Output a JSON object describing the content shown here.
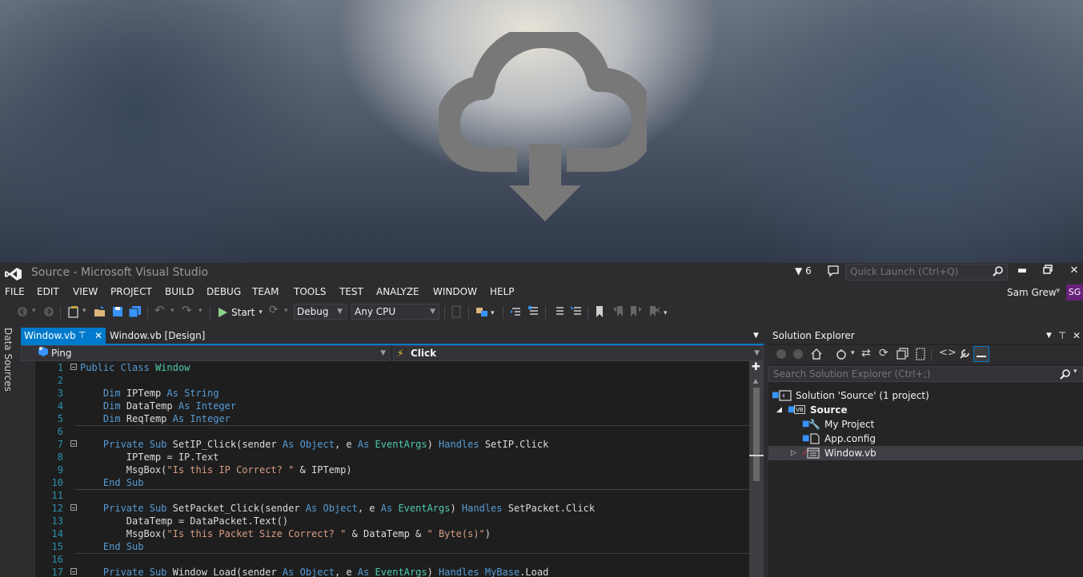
{
  "wallpaper": {
    "icon": "cloud-download-icon"
  },
  "titlebar": {
    "title": "Source - Microsoft Visual Studio",
    "notification_count": "6",
    "quick_launch_placeholder": "Quick Launch (Ctrl+Q)"
  },
  "menu": [
    "FILE",
    "EDIT",
    "VIEW",
    "PROJECT",
    "BUILD",
    "DEBUG",
    "TEAM",
    "TOOLS",
    "TEST",
    "ANALYZE",
    "WINDOW",
    "HELP"
  ],
  "user": {
    "name": "Sam Grew",
    "initials": "SG"
  },
  "toolbar": {
    "start_label": "Start",
    "config": "Debug",
    "platform": "Any CPU"
  },
  "side_panel": {
    "label": "Data Sources"
  },
  "tabs": {
    "active": "Window.vb",
    "inactive": "Window.vb [Design]"
  },
  "navbar": {
    "left": "Ping",
    "right": "Click"
  },
  "code_lines": [
    {
      "n": "1",
      "html": "<span class=\"kw\">Public</span> <span class=\"kw\">Class</span> <span class=\"ty\">Window</span>"
    },
    {
      "n": "2",
      "html": ""
    },
    {
      "n": "3",
      "html": "    <span class=\"kw\">Dim</span> IPTemp <span class=\"kw\">As</span> <span class=\"kw\">String</span>"
    },
    {
      "n": "4",
      "html": "    <span class=\"kw\">Dim</span> DataTemp <span class=\"kw\">As</span> <span class=\"kw\">Integer</span>"
    },
    {
      "n": "5",
      "html": "    <span class=\"kw\">Dim</span> ReqTemp <span class=\"kw\">As</span> <span class=\"kw\">Integer</span>"
    },
    {
      "n": "6",
      "html": ""
    },
    {
      "n": "7",
      "html": "    <span class=\"kw\">Private</span> <span class=\"kw\">Sub</span> SetIP_Click(sender <span class=\"kw\">As</span> <span class=\"kw\">Object</span>, e <span class=\"kw\">As</span> <span class=\"ty\">EventArgs</span>) <span class=\"kw\">Handles</span> SetIP.Click"
    },
    {
      "n": "8",
      "html": "        IPTemp = IP.Text"
    },
    {
      "n": "9",
      "html": "        MsgBox(<span class=\"st\">\"Is this IP Correct? \"</span> &amp; IPTemp)"
    },
    {
      "n": "10",
      "html": "    <span class=\"kw\">End</span> <span class=\"kw\">Sub</span>"
    },
    {
      "n": "11",
      "html": ""
    },
    {
      "n": "12",
      "html": "    <span class=\"kw\">Private</span> <span class=\"kw\">Sub</span> SetPacket_Click(sender <span class=\"kw\">As</span> <span class=\"kw\">Object</span>, e <span class=\"kw\">As</span> <span class=\"ty\">EventArgs</span>) <span class=\"kw\">Handles</span> SetPacket.Click"
    },
    {
      "n": "13",
      "html": "        DataTemp = DataPacket.Text()"
    },
    {
      "n": "14",
      "html": "        MsgBox(<span class=\"st\">\"Is this Packet Size Correct? \"</span> &amp; DataTemp &amp; <span class=\"st\">\" Byte(s)\"</span>)"
    },
    {
      "n": "15",
      "html": "    <span class=\"kw\">End</span> <span class=\"kw\">Sub</span>"
    },
    {
      "n": "16",
      "html": ""
    },
    {
      "n": "17",
      "html": "    <span class=\"kw\">Private</span> <span class=\"kw\">Sub</span> Window_Load(sender <span class=\"kw\">As</span> <span class=\"kw\">Object</span>, e <span class=\"kw\">As</span> <span class=\"ty\">EventArgs</span>) <span class=\"kw\">Handles</span> <span class=\"kw\">MyBase</span>.Load"
    }
  ],
  "solution_explorer": {
    "title": "Solution Explorer",
    "search_placeholder": "Search Solution Explorer (Ctrl+;)",
    "solution": "Solution 'Source' (1 project)",
    "project": "Source",
    "items": [
      "My Project",
      "App.config",
      "Window.vb"
    ]
  }
}
